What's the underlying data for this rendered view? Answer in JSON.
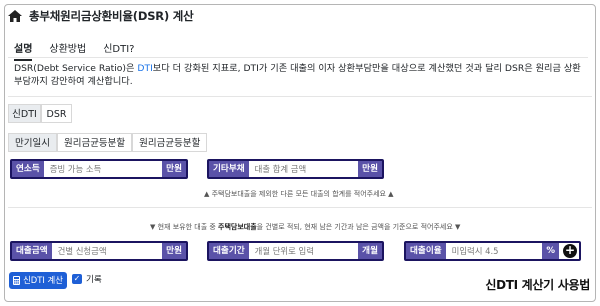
{
  "header": {
    "title": "총부채원리금상환비율(DSR) 계산"
  },
  "tabs": [
    {
      "label": "설명",
      "active": true
    },
    {
      "label": "상환방법",
      "active": false
    },
    {
      "label": "신DTI?",
      "active": false
    }
  ],
  "description": {
    "part1": "DSR(Debt Service Ratio)은 ",
    "highlight": "DTI",
    "part2": "보다 더 강화된 지표로, DTI가 기존 대출의 이자 상환부담만을 대상으로 계산했던 것과 달리 DSR은 원리금 상환 부담까지 감안하여 계산합니다."
  },
  "mode_toggle": {
    "options": [
      "신DTI",
      "DSR"
    ],
    "selected": "신DTI"
  },
  "repay_toggle": {
    "options": [
      "만기일시",
      "원리금균등분할",
      "원리금균등분할"
    ],
    "selected": "만기일시"
  },
  "fields": {
    "income": {
      "label": "연소득",
      "placeholder": "증빙 가능 소득",
      "unit": "만원"
    },
    "other_debt": {
      "label": "기타부채",
      "placeholder": "대출 합계 금액",
      "unit": "만원"
    },
    "loan_amount": {
      "label": "대출금액",
      "placeholder": "건별 신청금액",
      "unit": "만원"
    },
    "loan_period": {
      "label": "대출기간",
      "placeholder": "개월 단위로 입력",
      "unit": "개월"
    },
    "interest_rate": {
      "label": "대출이율",
      "placeholder": "미입력시 4.5",
      "unit": "%"
    }
  },
  "notes": {
    "other_debt_note": "▲ 주택담보대출을 제외한 다른 모든 대출의 합계를 적어주세요 ▲",
    "loan_note_part1": "▼ 현재 보유한 대출 중 ",
    "loan_note_bold": "주택담보대출",
    "loan_note_part2": "을 건별로 적되, 현재 남은 기간과 남은 금액을 기준으로 적어주세요 ▼"
  },
  "actions": {
    "calculate_label": "신DTI 계산",
    "record_label": "기록",
    "record_checked": true
  },
  "watermark": "신DTI 계산기 사용법",
  "colors": {
    "label_bg": "#5a52a8",
    "field_border": "#1b1460",
    "primary_button": "#1e5fd6",
    "link_highlight": "#1a73e8"
  }
}
